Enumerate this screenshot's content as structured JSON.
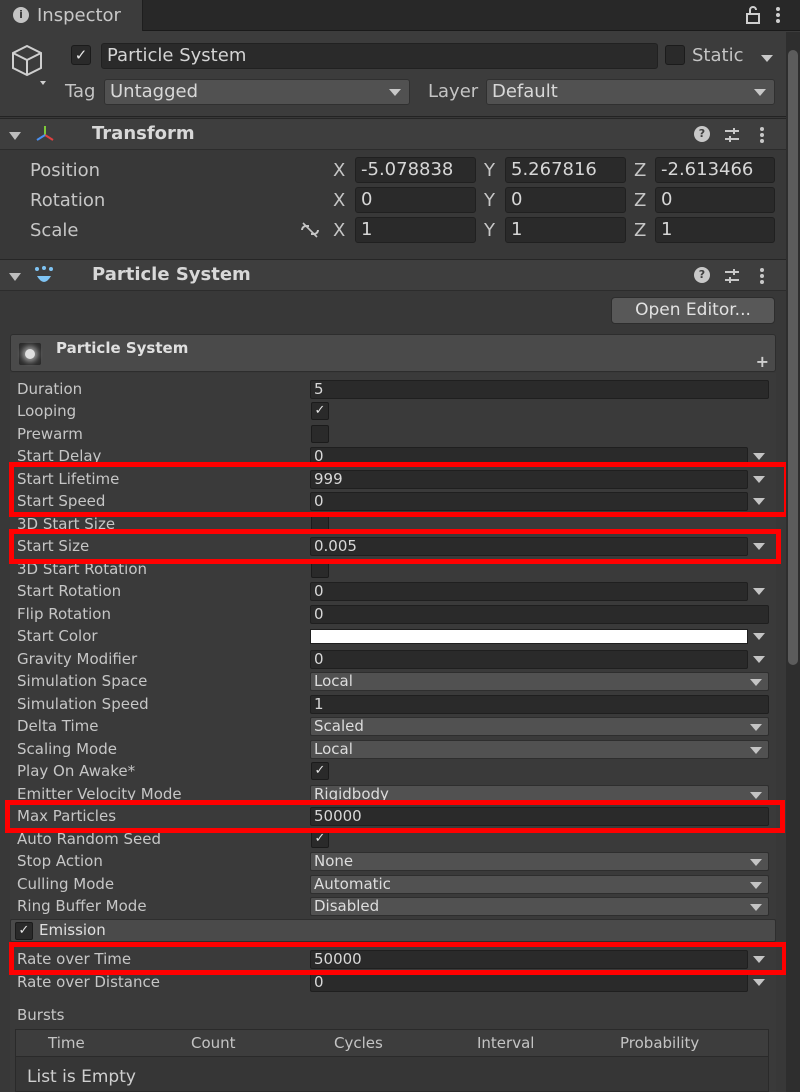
{
  "tab": {
    "title": "Inspector"
  },
  "header": {
    "object_name": "Particle System",
    "static_label": "Static",
    "tag_label": "Tag",
    "tag_value": "Untagged",
    "layer_label": "Layer",
    "layer_value": "Default"
  },
  "transform": {
    "title": "Transform",
    "rows": [
      {
        "label": "Position",
        "x": "-5.078838",
        "y": "5.267816",
        "z": "-2.613466"
      },
      {
        "label": "Rotation",
        "x": "0",
        "y": "0",
        "z": "0"
      },
      {
        "label": "Scale",
        "x": "1",
        "y": "1",
        "z": "1"
      }
    ],
    "axes": {
      "x": "X",
      "y": "Y",
      "z": "Z"
    }
  },
  "particle_component": {
    "title": "Particle System",
    "open_editor": "Open Editor...",
    "module_title": "Particle System",
    "plus": "+"
  },
  "props": {
    "duration": {
      "label": "Duration",
      "value": "5"
    },
    "looping": {
      "label": "Looping",
      "checked": true
    },
    "prewarm": {
      "label": "Prewarm",
      "checked": false
    },
    "start_delay": {
      "label": "Start Delay",
      "value": "0"
    },
    "start_lifetime": {
      "label": "Start Lifetime",
      "value": "999"
    },
    "start_speed": {
      "label": "Start Speed",
      "value": "0"
    },
    "start_size_3d": {
      "label": "3D Start Size",
      "checked": false
    },
    "start_size": {
      "label": "Start Size",
      "value": "0.005"
    },
    "start_rotation_3d": {
      "label": "3D Start Rotation",
      "checked": false
    },
    "start_rotation": {
      "label": "Start Rotation",
      "value": "0"
    },
    "flip_rotation": {
      "label": "Flip Rotation",
      "value": "0"
    },
    "start_color": {
      "label": "Start Color",
      "color": "#ffffff"
    },
    "gravity_modifier": {
      "label": "Gravity Modifier",
      "value": "0"
    },
    "simulation_space": {
      "label": "Simulation Space",
      "value": "Local"
    },
    "simulation_speed": {
      "label": "Simulation Speed",
      "value": "1"
    },
    "delta_time": {
      "label": "Delta Time",
      "value": "Scaled"
    },
    "scaling_mode": {
      "label": "Scaling Mode",
      "value": "Local"
    },
    "play_on_awake": {
      "label": "Play On Awake*",
      "checked": true
    },
    "emitter_velocity_mode": {
      "label": "Emitter Velocity Mode",
      "value": "Rigidbody"
    },
    "max_particles": {
      "label": "Max Particles",
      "value": "50000"
    },
    "auto_random_seed": {
      "label": "Auto Random Seed",
      "checked": true
    },
    "stop_action": {
      "label": "Stop Action",
      "value": "None"
    },
    "culling_mode": {
      "label": "Culling Mode",
      "value": "Automatic"
    },
    "ring_buffer_mode": {
      "label": "Ring Buffer Mode",
      "value": "Disabled"
    }
  },
  "emission": {
    "title": "Emission",
    "rate_over_time": {
      "label": "Rate over Time",
      "value": "50000"
    },
    "rate_over_distance": {
      "label": "Rate over Distance",
      "value": "0"
    },
    "bursts_label": "Bursts",
    "bursts_columns": [
      "Time",
      "Count",
      "Cycles",
      "Interval",
      "Probability"
    ],
    "bursts_empty": "List is Empty"
  },
  "icons": {
    "check": "✓",
    "lock": "lock-icon",
    "menu": "kebab-menu-icon"
  },
  "colors": {
    "highlight": "#ff0000",
    "background": "#383838"
  }
}
